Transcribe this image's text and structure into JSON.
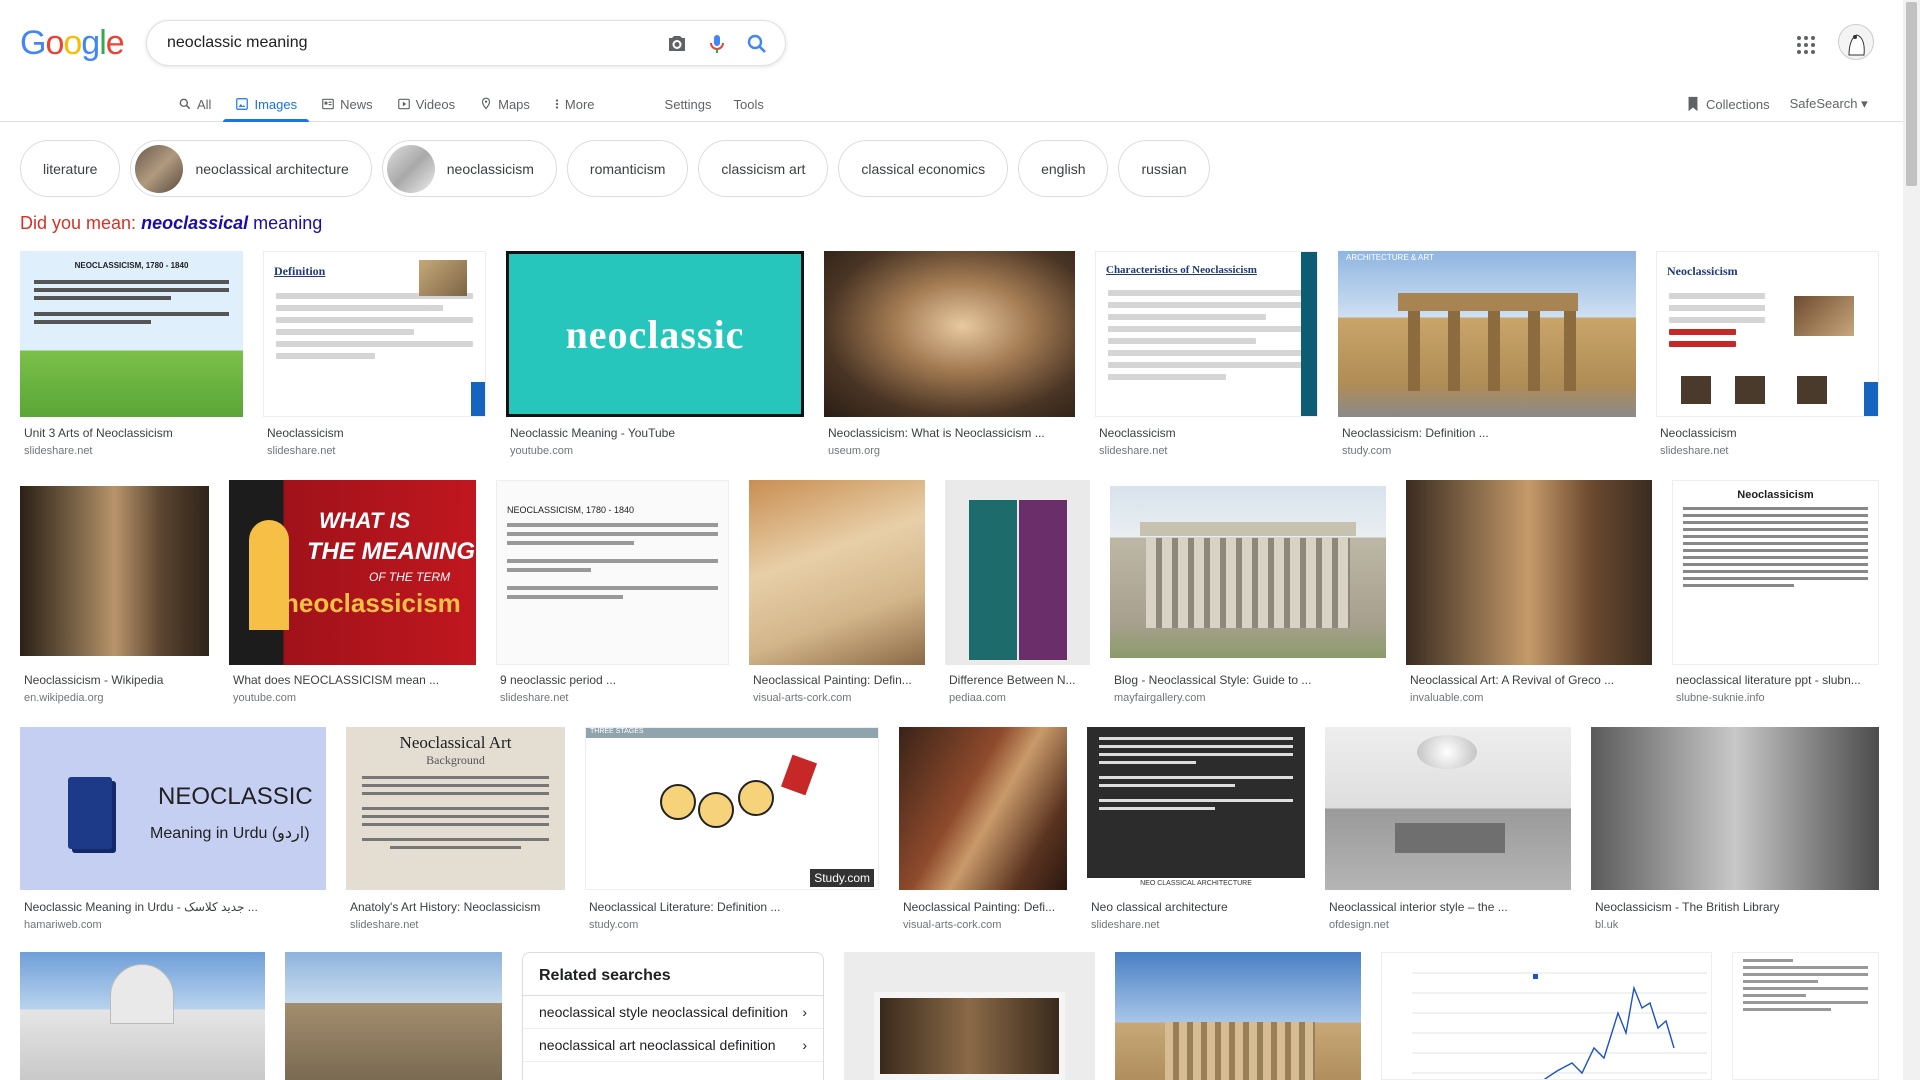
{
  "search": {
    "query": "neoclassic meaning"
  },
  "logo": [
    "G",
    "o",
    "o",
    "g",
    "l",
    "e"
  ],
  "tabs": [
    {
      "label": "All"
    },
    {
      "label": "Images"
    },
    {
      "label": "News"
    },
    {
      "label": "Videos"
    },
    {
      "label": "Maps"
    },
    {
      "label": "More"
    },
    {
      "label": "Settings"
    },
    {
      "label": "Tools"
    }
  ],
  "right": {
    "collections": "Collections",
    "safesearch": "SafeSearch"
  },
  "chips": [
    "literature",
    "neoclassical architecture",
    "neoclassicism",
    "romanticism",
    "classicism art",
    "classical economics",
    "english",
    "russian"
  ],
  "didyoumean": {
    "prefix": "Did you mean:",
    "bold": "neoclassical",
    "rest": "meaning"
  },
  "results": [
    {
      "cap": "Unit 3 Arts of Neoclassicism",
      "src": "slideshare.net"
    },
    {
      "cap": "Neoclassicism",
      "src": "slideshare.net"
    },
    {
      "cap": "Neoclassic Meaning - YouTube",
      "src": "youtube.com"
    },
    {
      "cap": "Neoclassicism: What is Neoclassicism ...",
      "src": "useum.org"
    },
    {
      "cap": "Neoclassicism",
      "src": "slideshare.net"
    },
    {
      "cap": "Neoclassicism: Definition ...",
      "src": "study.com"
    },
    {
      "cap": "Neoclassicism",
      "src": "slideshare.net"
    },
    {
      "cap": "Neoclassicism - Wikipedia",
      "src": "en.wikipedia.org"
    },
    {
      "cap": "What does NEOCLASSICISM mean ...",
      "src": "youtube.com"
    },
    {
      "cap": "9 neoclassic period ...",
      "src": "slideshare.net"
    },
    {
      "cap": "Neoclassical Painting: Defin...",
      "src": "visual-arts-cork.com"
    },
    {
      "cap": "Difference Between N...",
      "src": "pediaa.com"
    },
    {
      "cap": "Blog - Neoclassical Style: Guide to ...",
      "src": "mayfairgallery.com"
    },
    {
      "cap": "Neoclassical Art: A Revival of Greco ...",
      "src": "invaluable.com"
    },
    {
      "cap": "neoclassical literature ppt - slubn...",
      "src": "slubne-suknie.info"
    },
    {
      "cap": "Neoclassic Meaning in Urdu - جدید کلاسک ...",
      "src": "hamariweb.com"
    },
    {
      "cap": "Anatoly's Art History: Neoclassicism",
      "src": "slideshare.net"
    },
    {
      "cap": "Neoclassical Literature: Definition ...",
      "src": "study.com"
    },
    {
      "cap": "Neoclassical Painting: Defi...",
      "src": "visual-arts-cork.com"
    },
    {
      "cap": "Neo classical architecture",
      "src": "slideshare.net"
    },
    {
      "cap": "Neoclassical interior style – the ...",
      "src": "ofdesign.net"
    },
    {
      "cap": "Neoclassicism - The British Library",
      "src": "bl.uk"
    }
  ],
  "thumbs": {
    "t1_title": "NEOCLASSICISM, 1780 - 1840",
    "t2_title": "Definition",
    "t3_word": "neoclassic",
    "t5_title": "Characteristics of Neoclassicism",
    "t6_label": "ARCHITECTURE & ART",
    "t7_title": "Neoclassicism",
    "t9_l1": "WHAT IS",
    "t9_l2": "THE MEANING",
    "t9_l3": "OF THE TERM",
    "t9_l4": "neoclassicism",
    "t10_title": "NEOCLASSICISM, 1780 - 1840",
    "t15_title": "Neoclassicism",
    "t16_word": "NEOCLASSIC",
    "t16_sub": "Meaning in Urdu (اردو)",
    "t17_title": "Neoclassical Art",
    "t17_sub": "Background",
    "t18_label": "THREE STAGES",
    "t18_brand": "Study.com",
    "t20_caption": "NEO CLASSICAL ARCHITECTURE"
  },
  "related": {
    "title": "Related searches",
    "items": [
      "neoclassical style neoclassical definition",
      "neoclassical art neoclassical definition"
    ]
  }
}
